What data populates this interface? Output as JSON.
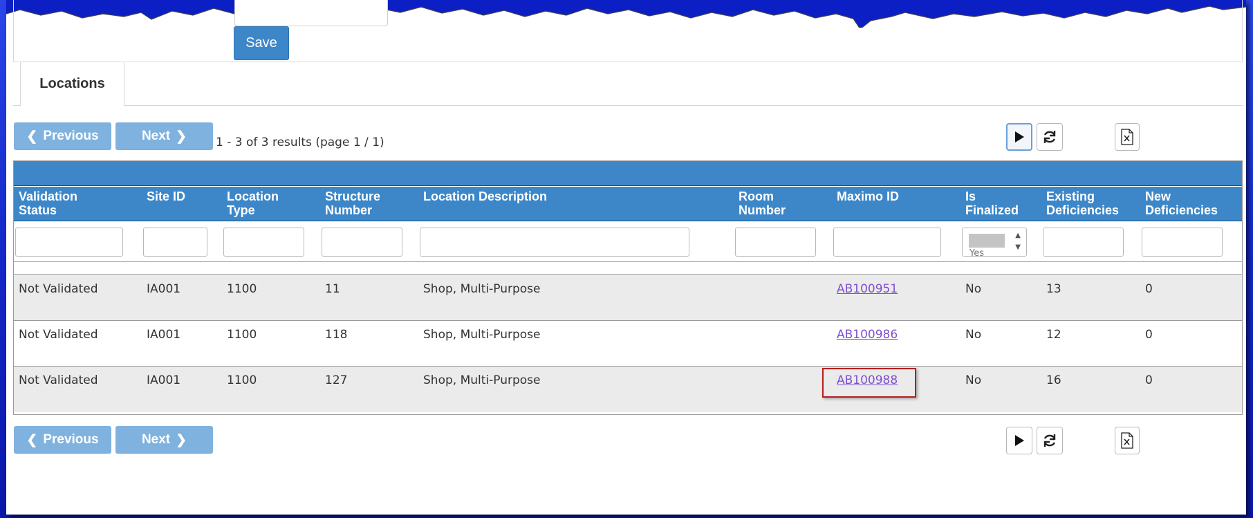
{
  "form": {
    "save_label": "Save"
  },
  "tabs": [
    {
      "label": "Locations"
    }
  ],
  "pager": {
    "previous_label": "Previous",
    "next_label": "Next",
    "results_text": "1 -  3 of  3 results (page  1 /  1)"
  },
  "toolbar_icons": [
    "play-icon",
    "refresh-icon",
    "excel-export-icon"
  ],
  "table": {
    "columns": [
      "Validation Status",
      "Site ID",
      "Location Type",
      "Structure Number",
      "Location Description",
      "Room Number",
      "Maximo ID",
      "Is Finalized",
      "Existing Deficiencies",
      "New Deficiencies"
    ],
    "header_lines": [
      [
        "Validation",
        "Status"
      ],
      [
        "Site ID",
        ""
      ],
      [
        "Location",
        "Type"
      ],
      [
        "Structure",
        "Number"
      ],
      [
        "Location Description",
        ""
      ],
      [
        "Room",
        "Number"
      ],
      [
        "Maximo ID",
        ""
      ],
      [
        "Is",
        "Finalized"
      ],
      [
        "Existing",
        "Deficiencies"
      ],
      [
        "New",
        "Deficiencies"
      ]
    ],
    "finalized_filter_value": "Yes",
    "rows": [
      {
        "validation_status": "Not Validated",
        "site_id": "IA001",
        "location_type": "1100",
        "structure_number": "11",
        "location_description": "Shop, Multi-Purpose",
        "room_number": "",
        "maximo_id": "AB100951",
        "is_finalized": "No",
        "existing_deficiencies": "13",
        "new_deficiencies": "0"
      },
      {
        "validation_status": "Not Validated",
        "site_id": "IA001",
        "location_type": "1100",
        "structure_number": "118",
        "location_description": "Shop, Multi-Purpose",
        "room_number": "",
        "maximo_id": "AB100986",
        "is_finalized": "No",
        "existing_deficiencies": "12",
        "new_deficiencies": "0"
      },
      {
        "validation_status": "Not Validated",
        "site_id": "IA001",
        "location_type": "1100",
        "structure_number": "127",
        "location_description": "Shop, Multi-Purpose",
        "room_number": "",
        "maximo_id": "AB100988",
        "is_finalized": "No",
        "existing_deficiencies": "16",
        "new_deficiencies": "0"
      }
    ]
  },
  "colors": {
    "header_blue": "#3d87c9",
    "pager_button": "#7fb2de",
    "link": "#7f4fd0",
    "highlight_border": "#b41e1e",
    "background": "#1428c8"
  }
}
